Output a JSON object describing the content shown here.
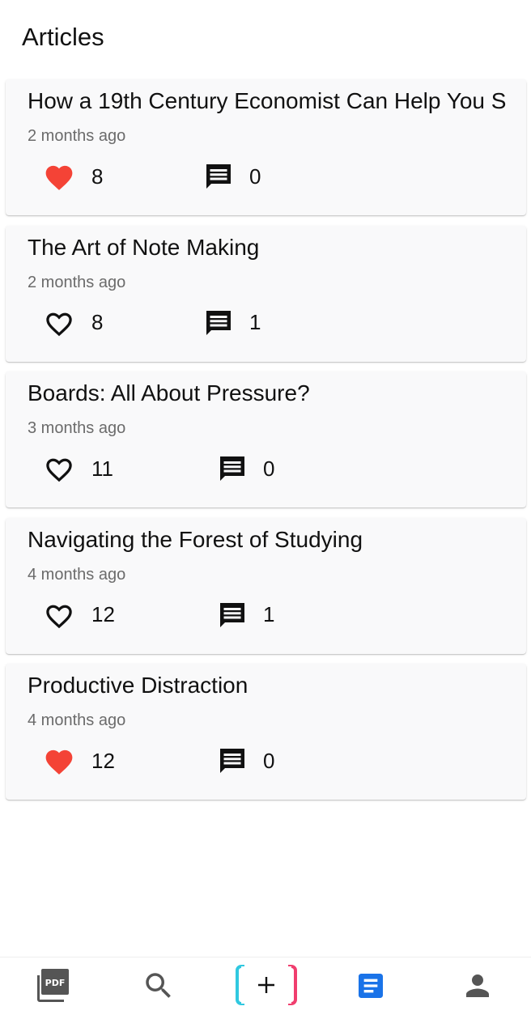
{
  "header": {
    "title": "Articles"
  },
  "articles": [
    {
      "title": "How a 19th Century Economist Can Help You S",
      "time": "2 months ago",
      "likes": "8",
      "liked": true,
      "comments": "0"
    },
    {
      "title": "The Art of Note Making",
      "time": "2 months ago",
      "likes": "8",
      "liked": false,
      "comments": "1"
    },
    {
      "title": "Boards: All About Pressure?",
      "time": "3 months ago",
      "likes": "11",
      "liked": false,
      "comments": "0"
    },
    {
      "title": "Navigating the Forest of Studying",
      "time": "4 months ago",
      "likes": "12",
      "liked": false,
      "comments": "1"
    },
    {
      "title": "Productive Distraction",
      "time": "4 months ago",
      "likes": "12",
      "liked": true,
      "comments": "0"
    }
  ],
  "bottom_nav": {
    "items": [
      {
        "icon": "pdf-icon",
        "label": "PDF",
        "active": false
      },
      {
        "icon": "search-icon",
        "active": false
      },
      {
        "icon": "plus-icon",
        "label": "+",
        "active": false
      },
      {
        "icon": "articles-icon",
        "active": true
      },
      {
        "icon": "person-icon",
        "active": false
      }
    ]
  },
  "colors": {
    "liked_heart": "#f44336",
    "active_nav": "#1a73e8",
    "inactive_nav": "#555555",
    "plus_left_bracket": "#30c8e0",
    "plus_right_bracket": "#f03e6e"
  }
}
